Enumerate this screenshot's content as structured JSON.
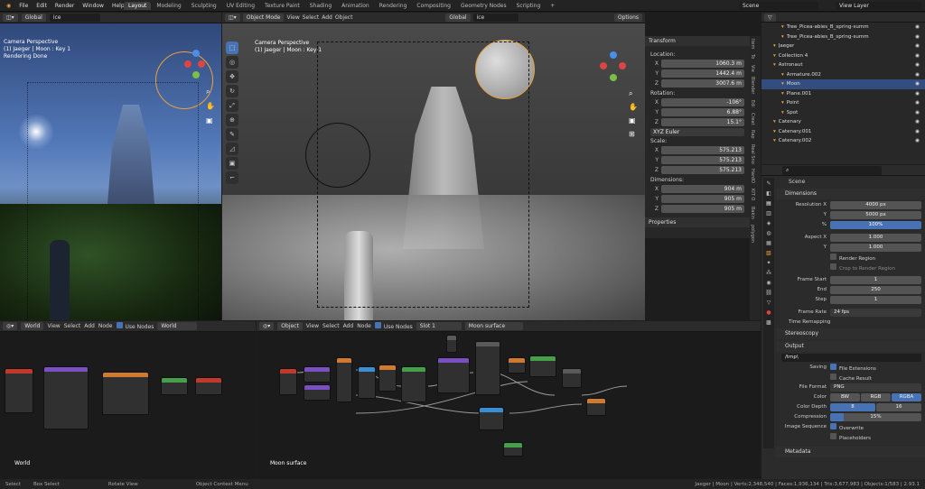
{
  "menu": [
    "File",
    "Edit",
    "Render",
    "Window",
    "Help"
  ],
  "workspaces": [
    "Layout",
    "Modeling",
    "Sculpting",
    "UV Editing",
    "Texture Paint",
    "Shading",
    "Animation",
    "Rendering",
    "Compositing",
    "Geometry Nodes",
    "Scripting"
  ],
  "scene_name": "Scene",
  "view_layer": "View Layer",
  "left_vp": {
    "mode_label": "Global",
    "search": "ice",
    "title": "Camera Perspective",
    "subtitle": "(1) Jaeger | Moon : Key 1",
    "status": "Rendering Done"
  },
  "main_vp": {
    "mode": "Object Mode",
    "menus": [
      "View",
      "Select",
      "Add",
      "Object"
    ],
    "orient": "Global",
    "search": "ice",
    "options": "Options",
    "title": "Camera Perspective",
    "subtitle": "(1) Jaeger | Moon : Key 1"
  },
  "transform": {
    "header": "Transform",
    "location_label": "Location:",
    "location": [
      [
        "X",
        "1060.3 m"
      ],
      [
        "Y",
        "1442.4 m"
      ],
      [
        "Z",
        "3007.6 m"
      ]
    ],
    "rotation_label": "Rotation:",
    "rotation": [
      [
        "X",
        "-106°"
      ],
      [
        "Y",
        "6.88°"
      ],
      [
        "Z",
        "15.1°"
      ]
    ],
    "euler": "XYZ Euler",
    "scale_label": "Scale:",
    "scale": [
      [
        "X",
        "575.213"
      ],
      [
        "Y",
        "575.213"
      ],
      [
        "Z",
        "575.213"
      ]
    ],
    "dimensions_label": "Dimensions:",
    "dimensions": [
      [
        "X",
        "904 m"
      ],
      [
        "Y",
        "905 m"
      ],
      [
        "Z",
        "905 m"
      ]
    ],
    "properties": "Properties"
  },
  "side_tabs": [
    "Item",
    "To",
    "Vie",
    "Blender",
    "Edi",
    "Creat",
    "Rap",
    "Real Sno",
    "HardO",
    "KIT O",
    "Bakin",
    "polygon"
  ],
  "outliner": [
    {
      "name": "Tree_Picea-abies_B_spring-summ",
      "indent": 2
    },
    {
      "name": "Tree_Picea-abies_B_spring-summ",
      "indent": 2
    },
    {
      "name": "Jaeger",
      "indent": 1
    },
    {
      "name": "Collection 4",
      "indent": 1
    },
    {
      "name": "Astronaut",
      "indent": 1
    },
    {
      "name": "Armature.002",
      "indent": 2
    },
    {
      "name": "Moon",
      "indent": 2,
      "selected": true
    },
    {
      "name": "Plane.001",
      "indent": 2
    },
    {
      "name": "Point",
      "indent": 2
    },
    {
      "name": "Spot",
      "indent": 2
    },
    {
      "name": "Catenary",
      "indent": 1
    },
    {
      "name": "Catenary.001",
      "indent": 1
    },
    {
      "name": "Catenary.002",
      "indent": 1
    }
  ],
  "props": {
    "scene": "Scene",
    "dimensions": "Dimensions",
    "res_x_label": "Resolution X",
    "res_x": "4000 px",
    "res_y_label": "Y",
    "res_y": "5000 px",
    "pct_label": "%",
    "pct": "100%",
    "aspect_x_label": "Aspect X",
    "aspect_x": "1.000",
    "aspect_y_label": "Y",
    "aspect_y": "1.000",
    "render_region": "Render Region",
    "crop": "Crop to Render Region",
    "frame_start_label": "Frame Start",
    "frame_start": "1",
    "end_label": "End",
    "end": "250",
    "step_label": "Step",
    "step": "1",
    "frame_rate_label": "Frame Rate",
    "frame_rate": "24 fps",
    "time_remap": "Time Remapping",
    "stereoscopy": "Stereoscopy",
    "output": "Output",
    "path": "/tmp\\",
    "saving_label": "Saving",
    "file_ext": "File Extensions",
    "cache": "Cache Result",
    "format_label": "File Format",
    "format": "PNG",
    "color_label": "Color",
    "color_opts": [
      "BW",
      "RGB",
      "RGBA"
    ],
    "depth_label": "Color Depth",
    "depth_opts": [
      "8",
      "16"
    ],
    "compression_label": "Compression",
    "compression": "15%",
    "image_seq_label": "Image Sequence",
    "overwrite": "Overwrite",
    "placeholders": "Placeholders",
    "metadata": "Metadata"
  },
  "node_left": {
    "type": "World",
    "menus": [
      "View",
      "Select",
      "Add",
      "Node"
    ],
    "use_nodes": "Use Nodes",
    "world": "World",
    "label": "World"
  },
  "node_right": {
    "type": "Object",
    "menus": [
      "View",
      "Select",
      "Add",
      "Node"
    ],
    "use_nodes": "Use Nodes",
    "slot": "Slot 1",
    "material": "Moon surface",
    "label": "Moon surface"
  },
  "status": {
    "select": "Select",
    "box": "Box Select",
    "rotate": "Rotate View",
    "ctx": "Object Context Menu",
    "stats": "Jaeger | Moon | Verts:2,348,540 | Faces:1,936,134 | Tris:3,677,983 | Objects:1/583 | 2.93.1"
  },
  "colors": {
    "accent": "#4772b3",
    "orange": "#e8a23a"
  }
}
